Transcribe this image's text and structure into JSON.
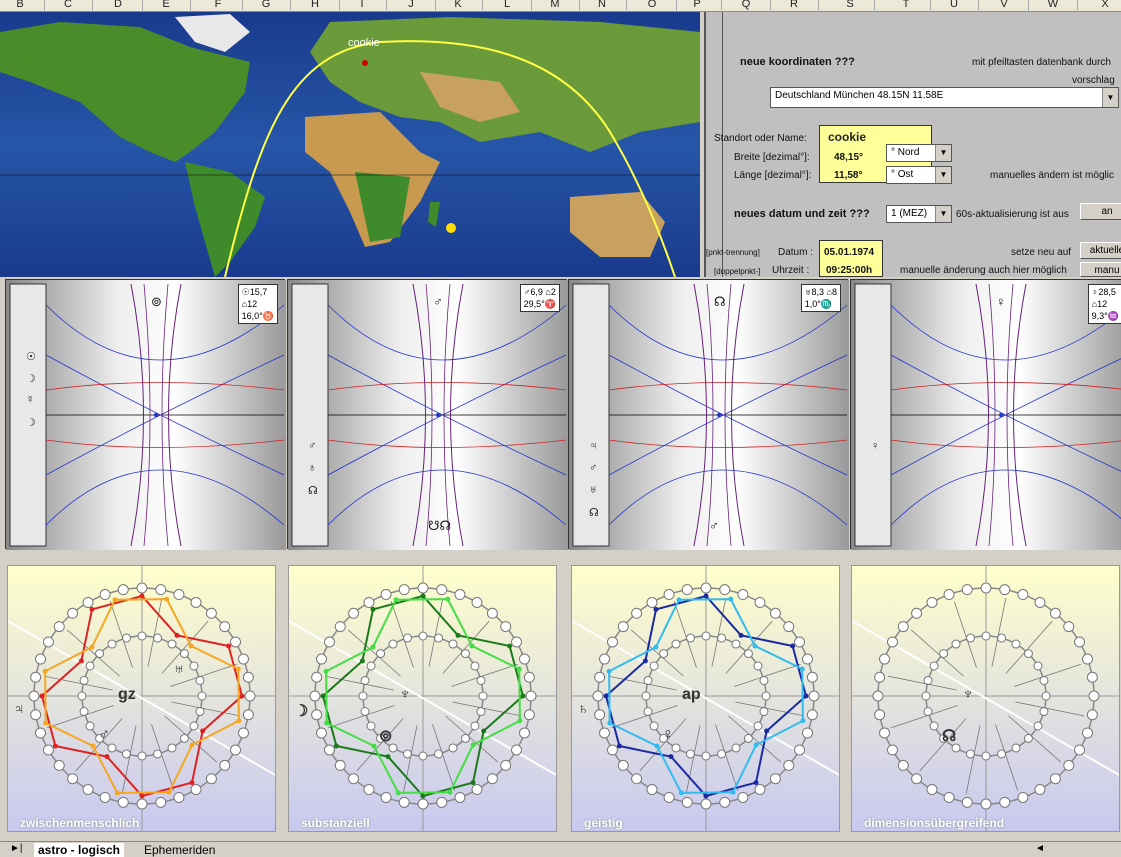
{
  "columns": [
    "B",
    "C",
    "D",
    "E",
    "F",
    "G",
    "H",
    "I",
    "J",
    "K",
    "L",
    "M",
    "N",
    "O",
    "P",
    "Q",
    "R",
    "S",
    "T",
    "U",
    "V",
    "W",
    "X"
  ],
  "map": {
    "place_label": "cookie"
  },
  "panel": {
    "coord_title": "neue koordinaten ???",
    "hint_db": "mit pfeiltasten datenbank durch",
    "suggestion": "vorschlag",
    "location_value": "Deutschland  München  48.15N  11.58E",
    "location_label": "Standort oder Name:",
    "name_value": "cookie",
    "lat_label": "Breite [dezimal°]:",
    "lat_value": "48,15°",
    "lat_dir": "° Nord",
    "lon_label": "Länge [dezimal°]:",
    "lon_value": "11,58°",
    "lon_dir": "° Ost",
    "manual_hint": "manuelles ändern ist möglic",
    "datetime_title": "neues  datum und zeit ???",
    "tz_value": "1 (MEZ)",
    "update_hint": "60s-aktualisierung ist aus",
    "update_btn": "an",
    "date_sep_label": "[pnkt-trennung]",
    "date_label": "Datum :",
    "date_value": "05.01.1974",
    "reset_label": "setze neu auf",
    "reset_btn": "aktuelle",
    "time_sep_label": "[doppelpnkt-]",
    "time_label": "Uhrzeit :",
    "time_value": "09:25:00h",
    "manual_time_hint": "manuelle änderung auch hier möglich",
    "manual_btn": "manu"
  },
  "charts": [
    {
      "info": [
        "☉15,7",
        "⌂12",
        "16,0°♉"
      ],
      "top_symbol": "⊚",
      "side_symbols": [
        "☉",
        "☽",
        "☿",
        "☽"
      ],
      "bottom_symbol": ""
    },
    {
      "info": [
        "♂6,9 ⌂2",
        "29,5°♈"
      ],
      "top_symbol": "♂",
      "side_symbols": [
        "♂",
        "♁",
        "☊"
      ],
      "bottom_symbol": "☋☊"
    },
    {
      "info": [
        "♅8,3 ⌂8",
        "1,0°♏"
      ],
      "top_symbol": "☊",
      "side_symbols": [
        "♃",
        "♂",
        "♅",
        "☊"
      ],
      "bottom_symbol": "♂"
    },
    {
      "info": [
        "♀28,5",
        "⌂12",
        "9,3°♒"
      ],
      "top_symbol": "♀",
      "side_symbols": [
        "♀"
      ],
      "bottom_symbol": ""
    }
  ],
  "wheels": [
    {
      "title": "zwischenmenschlich",
      "labels": [
        "gz",
        "♂",
        "♃",
        "♅"
      ],
      "colors": [
        "#dd2222",
        "#f5a623"
      ]
    },
    {
      "title": "substanziell",
      "labels": [
        "♆",
        "⊚",
        "☽"
      ],
      "colors": [
        "#1a7a1a",
        "#44dd44"
      ]
    },
    {
      "title": "geistig",
      "labels": [
        "ap",
        "♀",
        "♄"
      ],
      "colors": [
        "#1a2aa0",
        "#33bbee"
      ]
    },
    {
      "title": "dimensionsübergreifend",
      "labels": [
        "♆",
        "☊"
      ],
      "colors": []
    }
  ],
  "tabs": [
    "astro - logisch",
    "Ephemeriden"
  ]
}
